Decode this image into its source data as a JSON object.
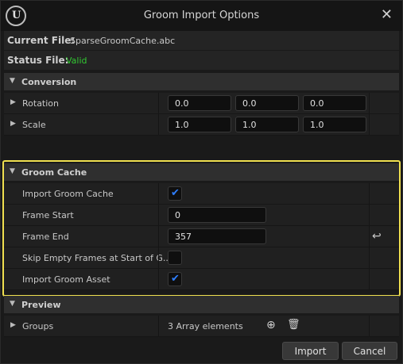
{
  "window": {
    "title": "Groom Import Options",
    "logo_text": "U",
    "close_glyph": "✕"
  },
  "current_file": {
    "label": "Current File:",
    "value": "SparseGroomCache.abc"
  },
  "status_file": {
    "label": "Status File:",
    "value": "Valid",
    "value_color": "#32c832"
  },
  "conversion": {
    "label": "Conversion",
    "rotation": {
      "label": "Rotation",
      "x": "0.0",
      "y": "0.0",
      "z": "0.0"
    },
    "scale": {
      "label": "Scale",
      "x": "1.0",
      "y": "1.0",
      "z": "1.0"
    }
  },
  "groom_cache": {
    "label": "Groom Cache",
    "import_groom_cache": {
      "label": "Import Groom Cache",
      "checked": true
    },
    "frame_start": {
      "label": "Frame Start",
      "value": "0"
    },
    "frame_end": {
      "label": "Frame End",
      "value": "357"
    },
    "skip_empty_frames": {
      "label": "Skip Empty Frames at Start of G...",
      "checked": false
    },
    "import_groom_asset": {
      "label": "Import Groom Asset",
      "checked": true
    },
    "highlight_color": "#f0e050"
  },
  "preview": {
    "label": "Preview",
    "groups": {
      "label": "Groups",
      "value": "3 Array elements"
    }
  },
  "icons": {
    "expanded_arrow": "▼",
    "collapsed_arrow": "▶",
    "check": "✔",
    "reset": "↩",
    "add": "⊕",
    "delete": "🗑"
  },
  "buttons": {
    "import": "Import",
    "cancel": "Cancel"
  },
  "accent_color": "#2f7fff"
}
